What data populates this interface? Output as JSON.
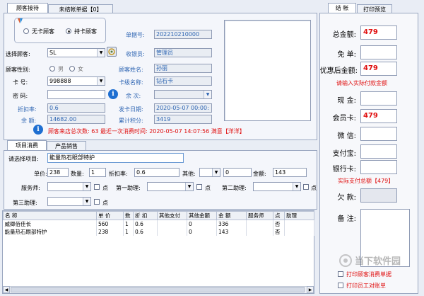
{
  "tabs": {
    "reception": "顾客接待",
    "unsettled": "未结帐单据【0】"
  },
  "card_type": {
    "no_card": "无卡顾客",
    "with_card": "持卡顾客"
  },
  "bill": {
    "receipt_no_label": "单据号:",
    "receipt_no": "202210210000",
    "cashier_label": "收银员:",
    "cashier": "管理员",
    "customer_name_label": "顾客姓名:",
    "customer_name": "孙丽",
    "card_level_label": "卡级名称:",
    "card_level": "钻石卡",
    "remaining_times_label": "余  次:",
    "issue_date_label": "发卡日期:",
    "issue_date": "2020-05-07 00:00:",
    "points_label": "累计积分:",
    "points": "3419"
  },
  "customer": {
    "select_label": "选择顾客:",
    "select_value": "SL",
    "gender_label": "顾客性别:",
    "male": "男",
    "female": "女",
    "card_no_label": "卡  号:",
    "card_no": "998888",
    "password_label": "密  码:",
    "discount_label": "折扣率:",
    "discount": "0.6",
    "balance_label": "余  额:",
    "balance": "14682.00"
  },
  "visit_info": "顾客来店总次数: 63   最近一次消费时间: 2020-05-07 14:07:56  满意【洋洋】",
  "sub_tabs": {
    "items": "项目消费",
    "products": "产品销售"
  },
  "entry": {
    "choose_label": "请选择项目:",
    "choose_value": "能量热石眼部特护",
    "price_label": "单价:",
    "price": "238",
    "qty_label": "数量:",
    "qty": "1",
    "rate_label": "折扣率:",
    "rate": "0.6",
    "other_label": "其他:",
    "other": "0",
    "amount_label": "金额:",
    "amount": "143",
    "servicer_label": "服务师:",
    "assist1_label": "第一助理:",
    "assist2_label": "第二助理:",
    "assist3_label": "第三助理:",
    "point_label": "点"
  },
  "table": {
    "headers": [
      "名 称",
      "单 价",
      "数",
      "折 扣",
      "其他支付",
      "其他金额",
      "金 额",
      "服务师",
      "点",
      "助理"
    ],
    "rows": [
      [
        "威卿佰佳长",
        "560",
        "1",
        "0.6",
        "",
        "0",
        "336",
        "",
        "否",
        ""
      ],
      [
        "能量热石眼部特护",
        "238",
        "1",
        "0.6",
        "",
        "0",
        "143",
        "",
        "否",
        ""
      ]
    ]
  },
  "right_tabs": {
    "checkout": "结 帐",
    "print": "打印预览"
  },
  "checkout": {
    "total_label": "总金额:",
    "total": "479",
    "free_label": "免  单:",
    "after_discount_label": "优惠后金额:",
    "after_discount": "479",
    "prompt": "请输入实际付款金额",
    "cash_label": "现  金:",
    "member_label": "会员卡:",
    "member": "479",
    "wechat_label": "微  信:",
    "alipay_label": "支付宝:",
    "bank_label": "银行卡:",
    "actual_total": "实际支付总额【479】",
    "owed_label": "欠  款:",
    "note_label": "备  注:",
    "print_receipt": "打印顾客消费单据",
    "print_staff": "打印员工对账单"
  },
  "watermark": "当下软件园",
  "colors": {
    "accent": "#2f66b3",
    "alert": "#e01010",
    "panel": "#f4f6fb"
  }
}
